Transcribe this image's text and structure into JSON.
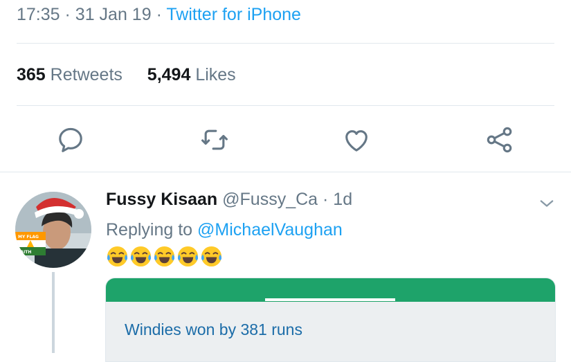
{
  "tweet": {
    "time": "17:35",
    "date": "31 Jan 19",
    "separator": "·",
    "source": "Twitter for iPhone",
    "retweet_count": "365",
    "retweet_label": "Retweets",
    "like_count": "5,494",
    "like_label": "Likes"
  },
  "actions": {
    "reply_icon": "reply-icon",
    "retweet_icon": "retweet-icon",
    "like_icon": "heart-icon",
    "share_icon": "share-icon",
    "icon_color": "#657786"
  },
  "reply": {
    "display_name": "Fussy Kisaan",
    "handle": "@Fussy_Ca",
    "separator": "·",
    "age": "1d",
    "replying_prefix": "Replying to",
    "replying_to": "@MichaelVaughan",
    "emoji": "😂😂😂😂😂",
    "avatar_badge_top": "MY FLAG",
    "avatar_badge_bottom": "FAITH",
    "card": {
      "headline": "Windies won by 381 runs",
      "header_color": "#1ea36a"
    }
  },
  "colors": {
    "link": "#1da1f2",
    "muted": "#657786",
    "divider": "#e1e8ed"
  }
}
